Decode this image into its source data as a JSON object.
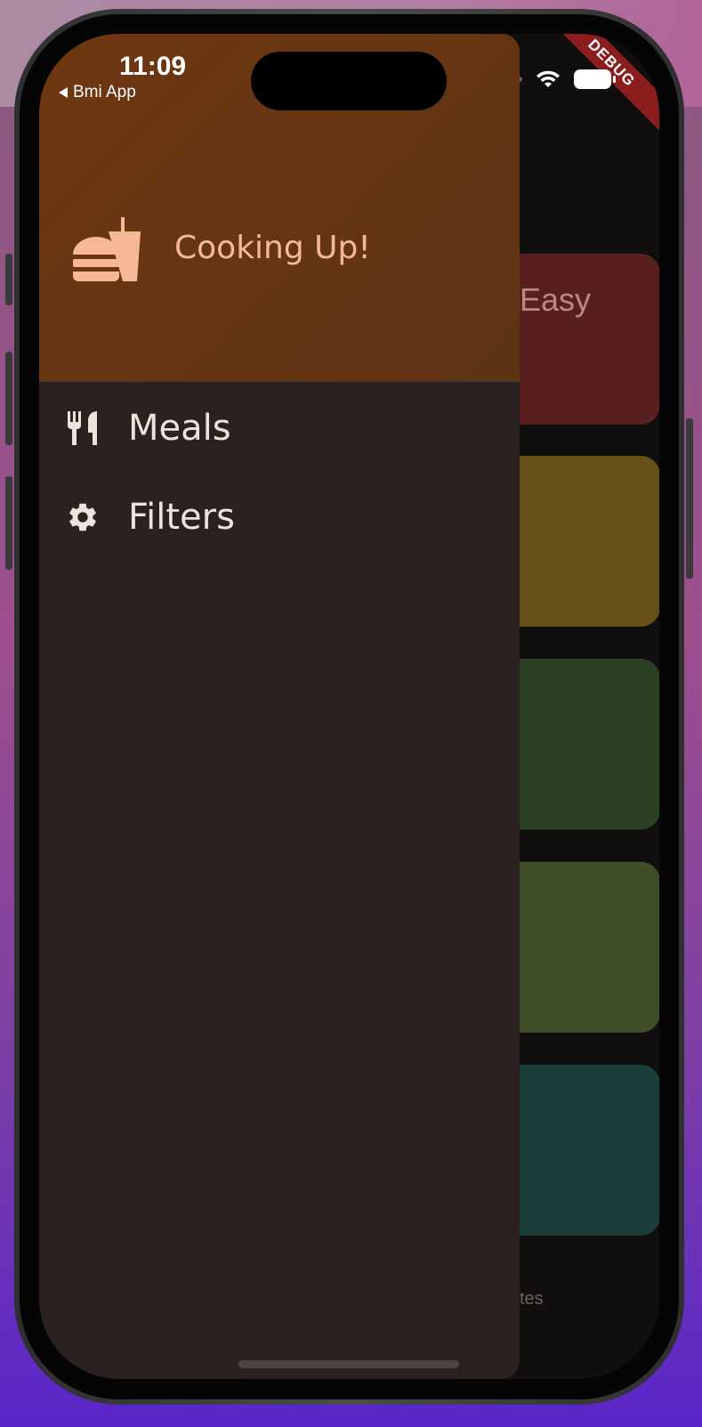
{
  "status_bar": {
    "time": "11:09",
    "back_app": "Bmi App",
    "icons": [
      "wifi-icon",
      "battery-icon"
    ]
  },
  "debug_banner": "DEBUG",
  "drawer": {
    "header": {
      "icon": "fastfood-icon",
      "title": "Cooking Up!",
      "background_color": "#6e3712",
      "title_color": "#f6b896"
    },
    "items": [
      {
        "icon": "restaurant-icon",
        "label": "Meals"
      },
      {
        "icon": "settings-gear-icon",
        "label": "Filters"
      }
    ],
    "background_color": "#2a2120"
  },
  "background_screen": {
    "partial_tile_label": "Easy",
    "partial_nav_label": "tes",
    "tile_colors": [
      "#5a201f",
      "#655118",
      "#2a4223",
      "#3f4e26",
      "#1a3f3b"
    ]
  }
}
